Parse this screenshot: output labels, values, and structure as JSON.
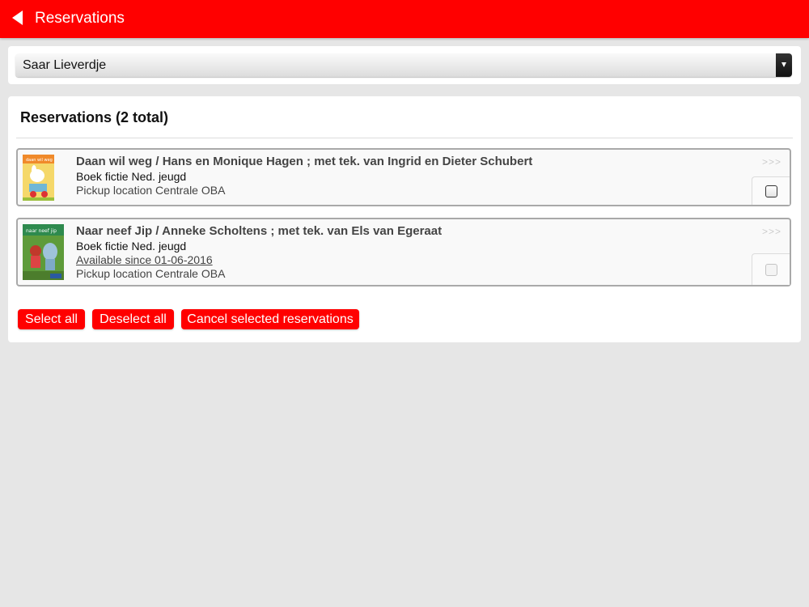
{
  "header": {
    "title": "Reservations",
    "back_icon": "back-arrow-icon",
    "color": "#ff0000"
  },
  "account_select": {
    "value": "Saar Lieverdje",
    "icon": "dropdown-arrow-icon"
  },
  "reservations": {
    "heading": "Reservations (2 total)",
    "items": [
      {
        "title": "Daan wil weg / Hans en Monique Hagen ; met tek. van Ingrid en Dieter Schubert",
        "type": "Boek fictie Ned. jeugd",
        "available": "",
        "pickup": "Pickup location Centrale OBA",
        "more": ">>>",
        "cover_text": "daan wil weg",
        "checkbox_enabled": true
      },
      {
        "title": "Naar neef Jip / Anneke Scholtens ; met tek. van Els van Egeraat",
        "type": "Boek fictie Ned. jeugd",
        "available": "Available since 01-06-2016",
        "pickup": "Pickup location Centrale OBA",
        "more": ">>>",
        "cover_text": "naar neef jip",
        "checkbox_enabled": false
      }
    ]
  },
  "actions": {
    "select_all": "Select all",
    "deselect_all": "Deselect all",
    "cancel_selected": "Cancel selected reservations"
  }
}
